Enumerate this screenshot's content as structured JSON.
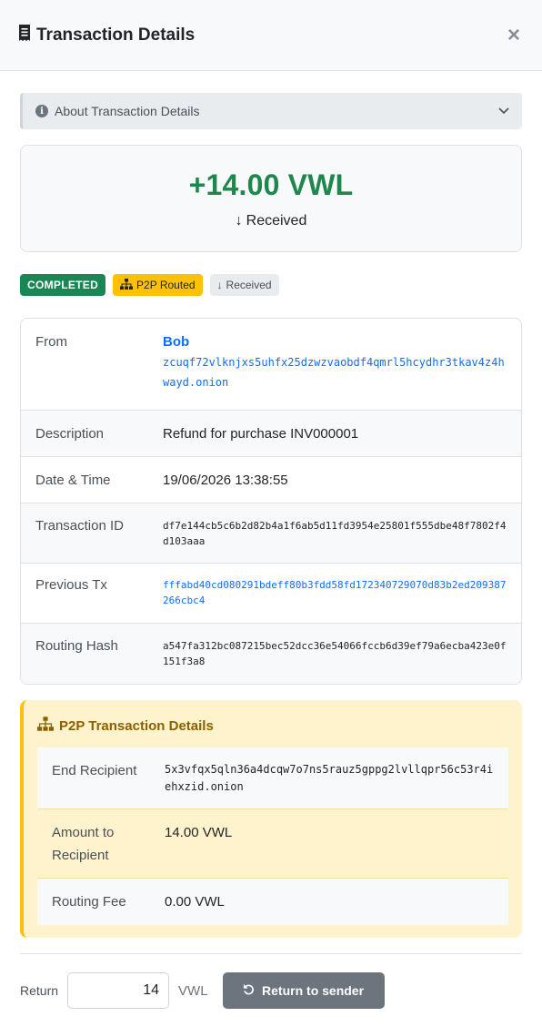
{
  "header": {
    "title": "Transaction Details",
    "close_label": "×"
  },
  "about": {
    "label": "About Transaction Details"
  },
  "summary": {
    "amount": "+14.00 VWL",
    "direction_arrow": "↓",
    "direction": "Received",
    "amount_color": "#1e874b"
  },
  "badges": {
    "status": "COMPLETED",
    "routing": "P2P Routed",
    "direction_arrow": "↓",
    "direction": "Received"
  },
  "details": {
    "from_label": "From",
    "from_name": "Bob",
    "from_address": "zcuqf72vlknjxs5uhfx25dzwzvaobdf4qmrl5hcydhr3tkav4z4hwayd.onion",
    "description_label": "Description",
    "description": "Refund for purchase INV000001",
    "datetime_label": "Date & Time",
    "datetime": "19/06/2026 13:38:55",
    "txid_label": "Transaction ID",
    "txid": "df7e144cb5c6b2d82b4a1f6ab5d11fd3954e25801f555dbe48f7802f4d103aaa",
    "prev_tx_label": "Previous Tx",
    "prev_tx": "fffabd40cd080291bdeff80b3fdd58fd172340729070d83b2ed209387266cbc4",
    "routing_hash_label": "Routing Hash",
    "routing_hash": "a547fa312bc087215bec52dcc36e54066fccb6d39ef79a6ecba423e0f151f3a8"
  },
  "p2p": {
    "title": "P2P Transaction Details",
    "end_recipient_label": "End Recipient",
    "end_recipient": "5x3vfqx5qln36a4dcqw7o7ns5rauz5gppg2lvllqpr56c53r4iehxzid.onion",
    "amount_label": "Amount to Recipient",
    "amount": "14.00 VWL",
    "fee_label": "Routing Fee",
    "fee": "0.00 VWL"
  },
  "footer": {
    "return_label": "Return",
    "return_value": "14",
    "unit": "VWL",
    "button_label": "Return to sender"
  },
  "colors": {
    "success": "#198754",
    "warning": "#ffc107",
    "link": "#0d6efd",
    "secondary": "#6c757d"
  }
}
